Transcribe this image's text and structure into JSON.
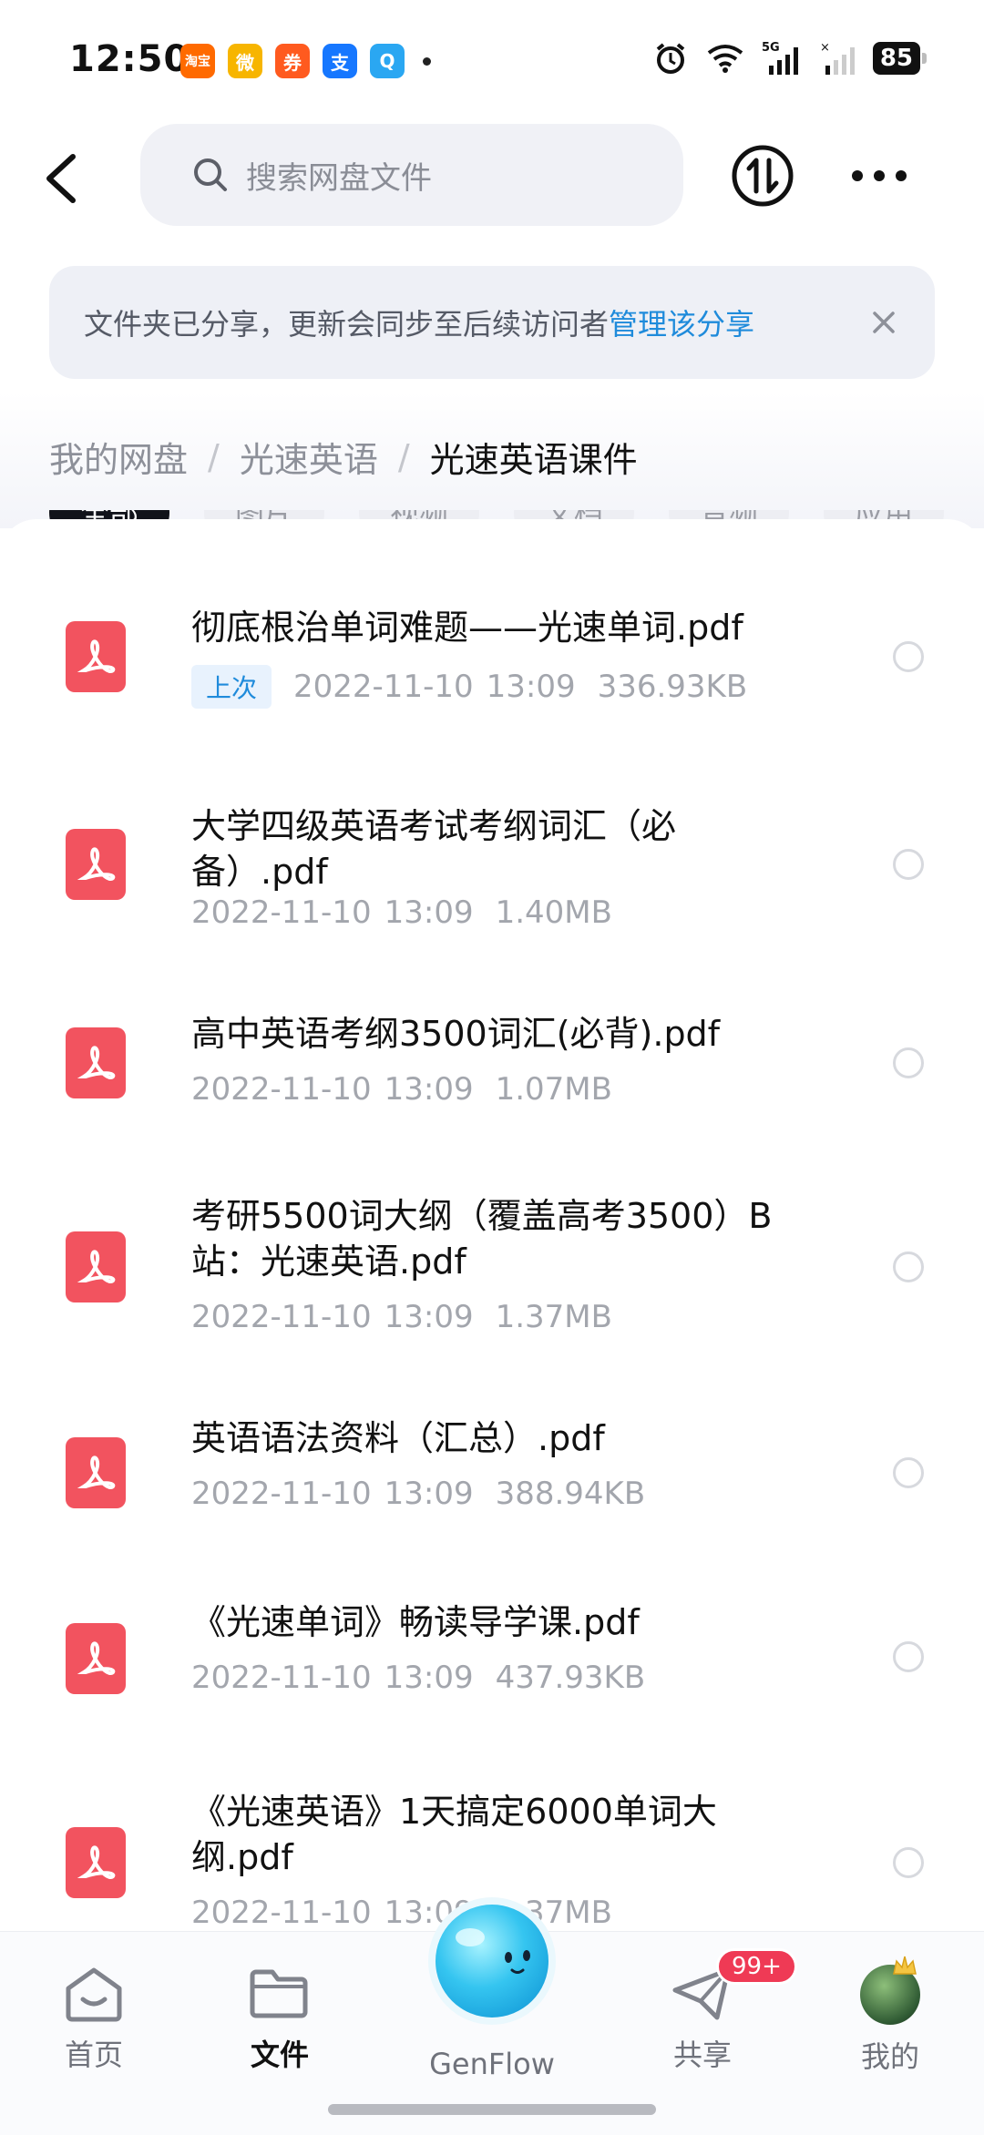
{
  "status_bar": {
    "time": "12:50",
    "battery": "85",
    "network": "5G",
    "apps": [
      {
        "name": "taobao-flash-icon",
        "label": "淘宝",
        "color": "#ff6a00"
      },
      {
        "name": "weibo-icon",
        "label": "微",
        "color": "#f7b500"
      },
      {
        "name": "notification-app-icon",
        "label": "券",
        "color": "#ff5a1f"
      },
      {
        "name": "alipay-icon",
        "label": "支",
        "color": "#1677ff"
      },
      {
        "name": "qq-browser-icon",
        "label": "Q",
        "color": "#2aa7f2"
      }
    ]
  },
  "search": {
    "placeholder": "搜索网盘文件"
  },
  "banner": {
    "text": "文件夹已分享，更新会同步至后续访问者",
    "link": "管理该分享"
  },
  "breadcrumb": {
    "root": "我的网盘",
    "parent": "光速英语",
    "current": "光速英语课件",
    "separator": "/"
  },
  "tabs": [
    {
      "label": "全部",
      "active": true
    },
    {
      "label": "图片",
      "active": false
    },
    {
      "label": "视频",
      "active": false
    },
    {
      "label": "文档",
      "active": false
    },
    {
      "label": "音频",
      "active": false
    },
    {
      "label": "应用",
      "active": false
    }
  ],
  "files": [
    {
      "name": "彻底根治单词难题——光速单词.pdf",
      "badge": "上次",
      "date": "2022-11-10",
      "time": "13:09",
      "size": "336.93KB"
    },
    {
      "name": "大学四级英语考试考纲词汇（必备）.pdf",
      "date": "2022-11-10",
      "time": "13:09",
      "size": "1.40MB"
    },
    {
      "name": "高中英语考纲3500词汇(必背).pdf",
      "date": "2022-11-10",
      "time": "13:09",
      "size": "1.07MB"
    },
    {
      "name": "考研5500词大纲（覆盖高考3500）B站：光速英语.pdf",
      "date": "2022-11-10",
      "time": "13:09",
      "size": "1.37MB"
    },
    {
      "name": "英语语法资料（汇总）.pdf",
      "date": "2022-11-10",
      "time": "13:09",
      "size": "388.94KB"
    },
    {
      "name": "《光速单词》畅读导学课.pdf",
      "date": "2022-11-10",
      "time": "13:09",
      "size": "437.93KB"
    },
    {
      "name": "《光速英语》1天搞定6000单词大纲.pdf",
      "date": "2022-11-10",
      "time": "13:09",
      "size": "1.37MB"
    }
  ],
  "nav": {
    "home": "首页",
    "files": "文件",
    "genflow": "GenFlow",
    "share": "共享",
    "share_badge": "99+",
    "mine": "我的"
  },
  "colors": {
    "accent": "#1f8bdb",
    "pdf": "#f2535f",
    "badge": "#ef3a55"
  }
}
